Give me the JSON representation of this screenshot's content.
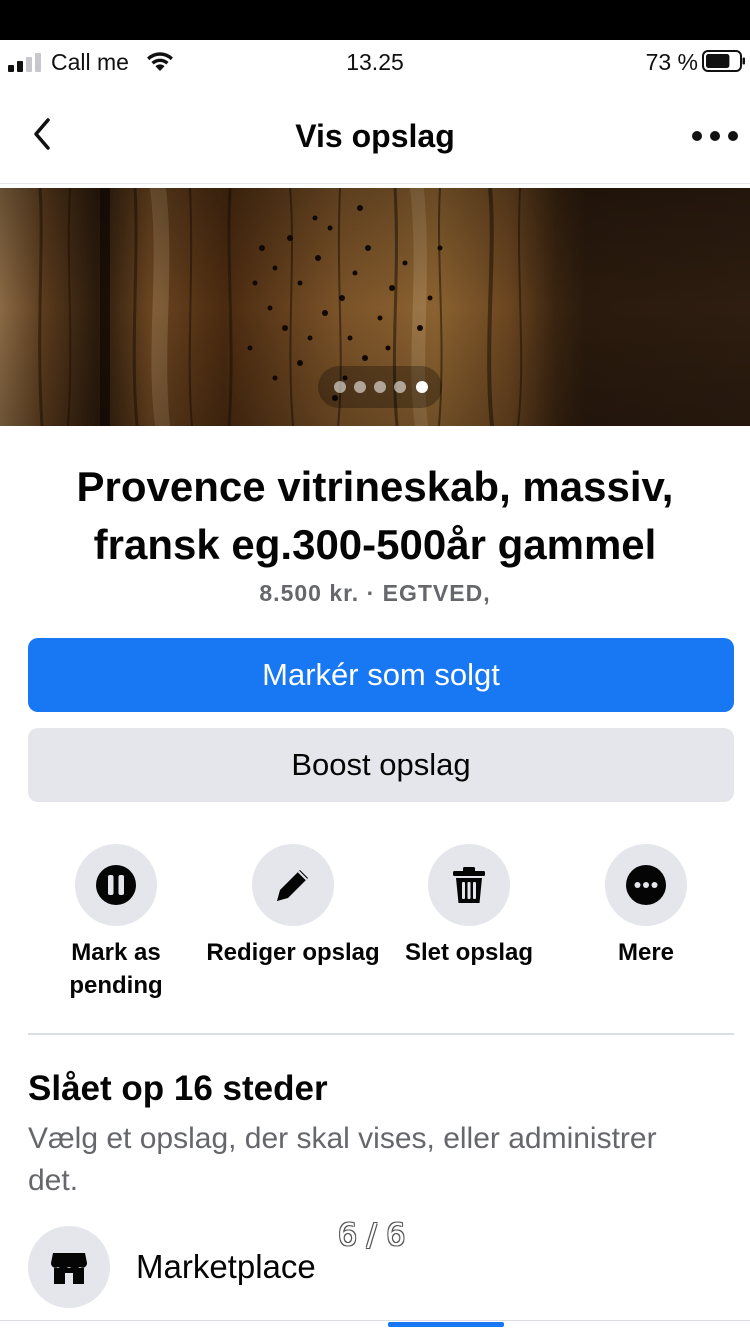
{
  "status_bar": {
    "carrier": "Call me",
    "time": "13.25",
    "battery": "73 %",
    "battery_level": 0.73,
    "icons": [
      "signal-icon",
      "wifi-icon",
      "battery-icon"
    ]
  },
  "nav": {
    "title": "Vis opslag",
    "back_icon": "chevron-left-icon",
    "more_icon": "more-horizontal-icon"
  },
  "gallery": {
    "image": "wooden-cabinet-photo",
    "dot_count": 5,
    "active_dot": 5
  },
  "listing": {
    "title": "Provence vitrineskab, massiv, fransk eg.300-500år gammel",
    "meta": "8.500 kr. · EGTVED,"
  },
  "buttons": {
    "mark_sold": "Markér som solgt",
    "boost": "Boost opslag"
  },
  "actions": [
    {
      "label": "Mark as pending",
      "icon": "pause-icon"
    },
    {
      "label": "Rediger opslag",
      "icon": "pencil-icon"
    },
    {
      "label": "Slet opslag",
      "icon": "trash-icon"
    },
    {
      "label": "Mere",
      "icon": "more-circle-icon"
    }
  ],
  "posted": {
    "heading": "Slået op 16 steder",
    "subtext": "Vælg et opslag, der skal vises, eller administrer det."
  },
  "marketplace": {
    "label": "Marketplace",
    "icon": "storefront-icon"
  },
  "page_indicator": "6 / 6",
  "colors": {
    "accent": "#1877f2",
    "secondary_button": "#e4e6eb",
    "muted_text": "#65676b"
  }
}
